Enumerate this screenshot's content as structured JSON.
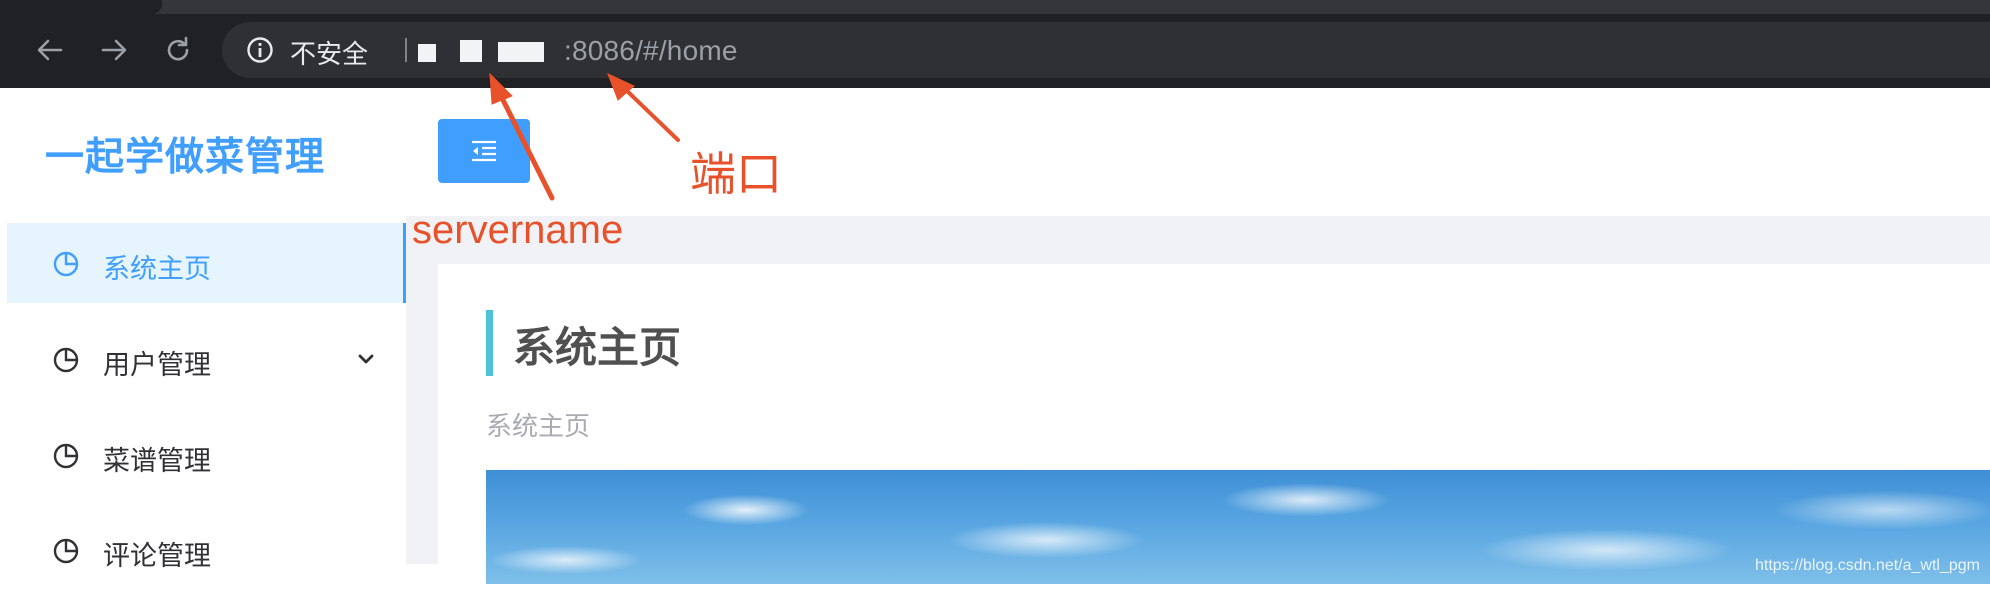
{
  "browser": {
    "security_label": "不安全",
    "url_visible": ":8086/#/home"
  },
  "sidebar": {
    "brand": "一起学做菜管理",
    "items": [
      {
        "label": "系统主页",
        "icon": "pie-chart-icon",
        "active": true
      },
      {
        "label": "用户管理",
        "icon": "pie-chart-icon",
        "has_submenu": true
      },
      {
        "label": "菜谱管理",
        "icon": "pie-chart-icon"
      },
      {
        "label": "评论管理",
        "icon": "pie-chart-icon"
      }
    ]
  },
  "main": {
    "card_title": "系统主页",
    "card_subtitle": "系统主页"
  },
  "annotations": {
    "port_label": "端口",
    "servername_label": "servername",
    "color": "#e8522b"
  },
  "watermark": "https://blog.csdn.net/a_wtl_pgm",
  "colors": {
    "accent": "#409eff",
    "chrome_bg": "#202124",
    "title_bar": "#4ec0d7"
  }
}
